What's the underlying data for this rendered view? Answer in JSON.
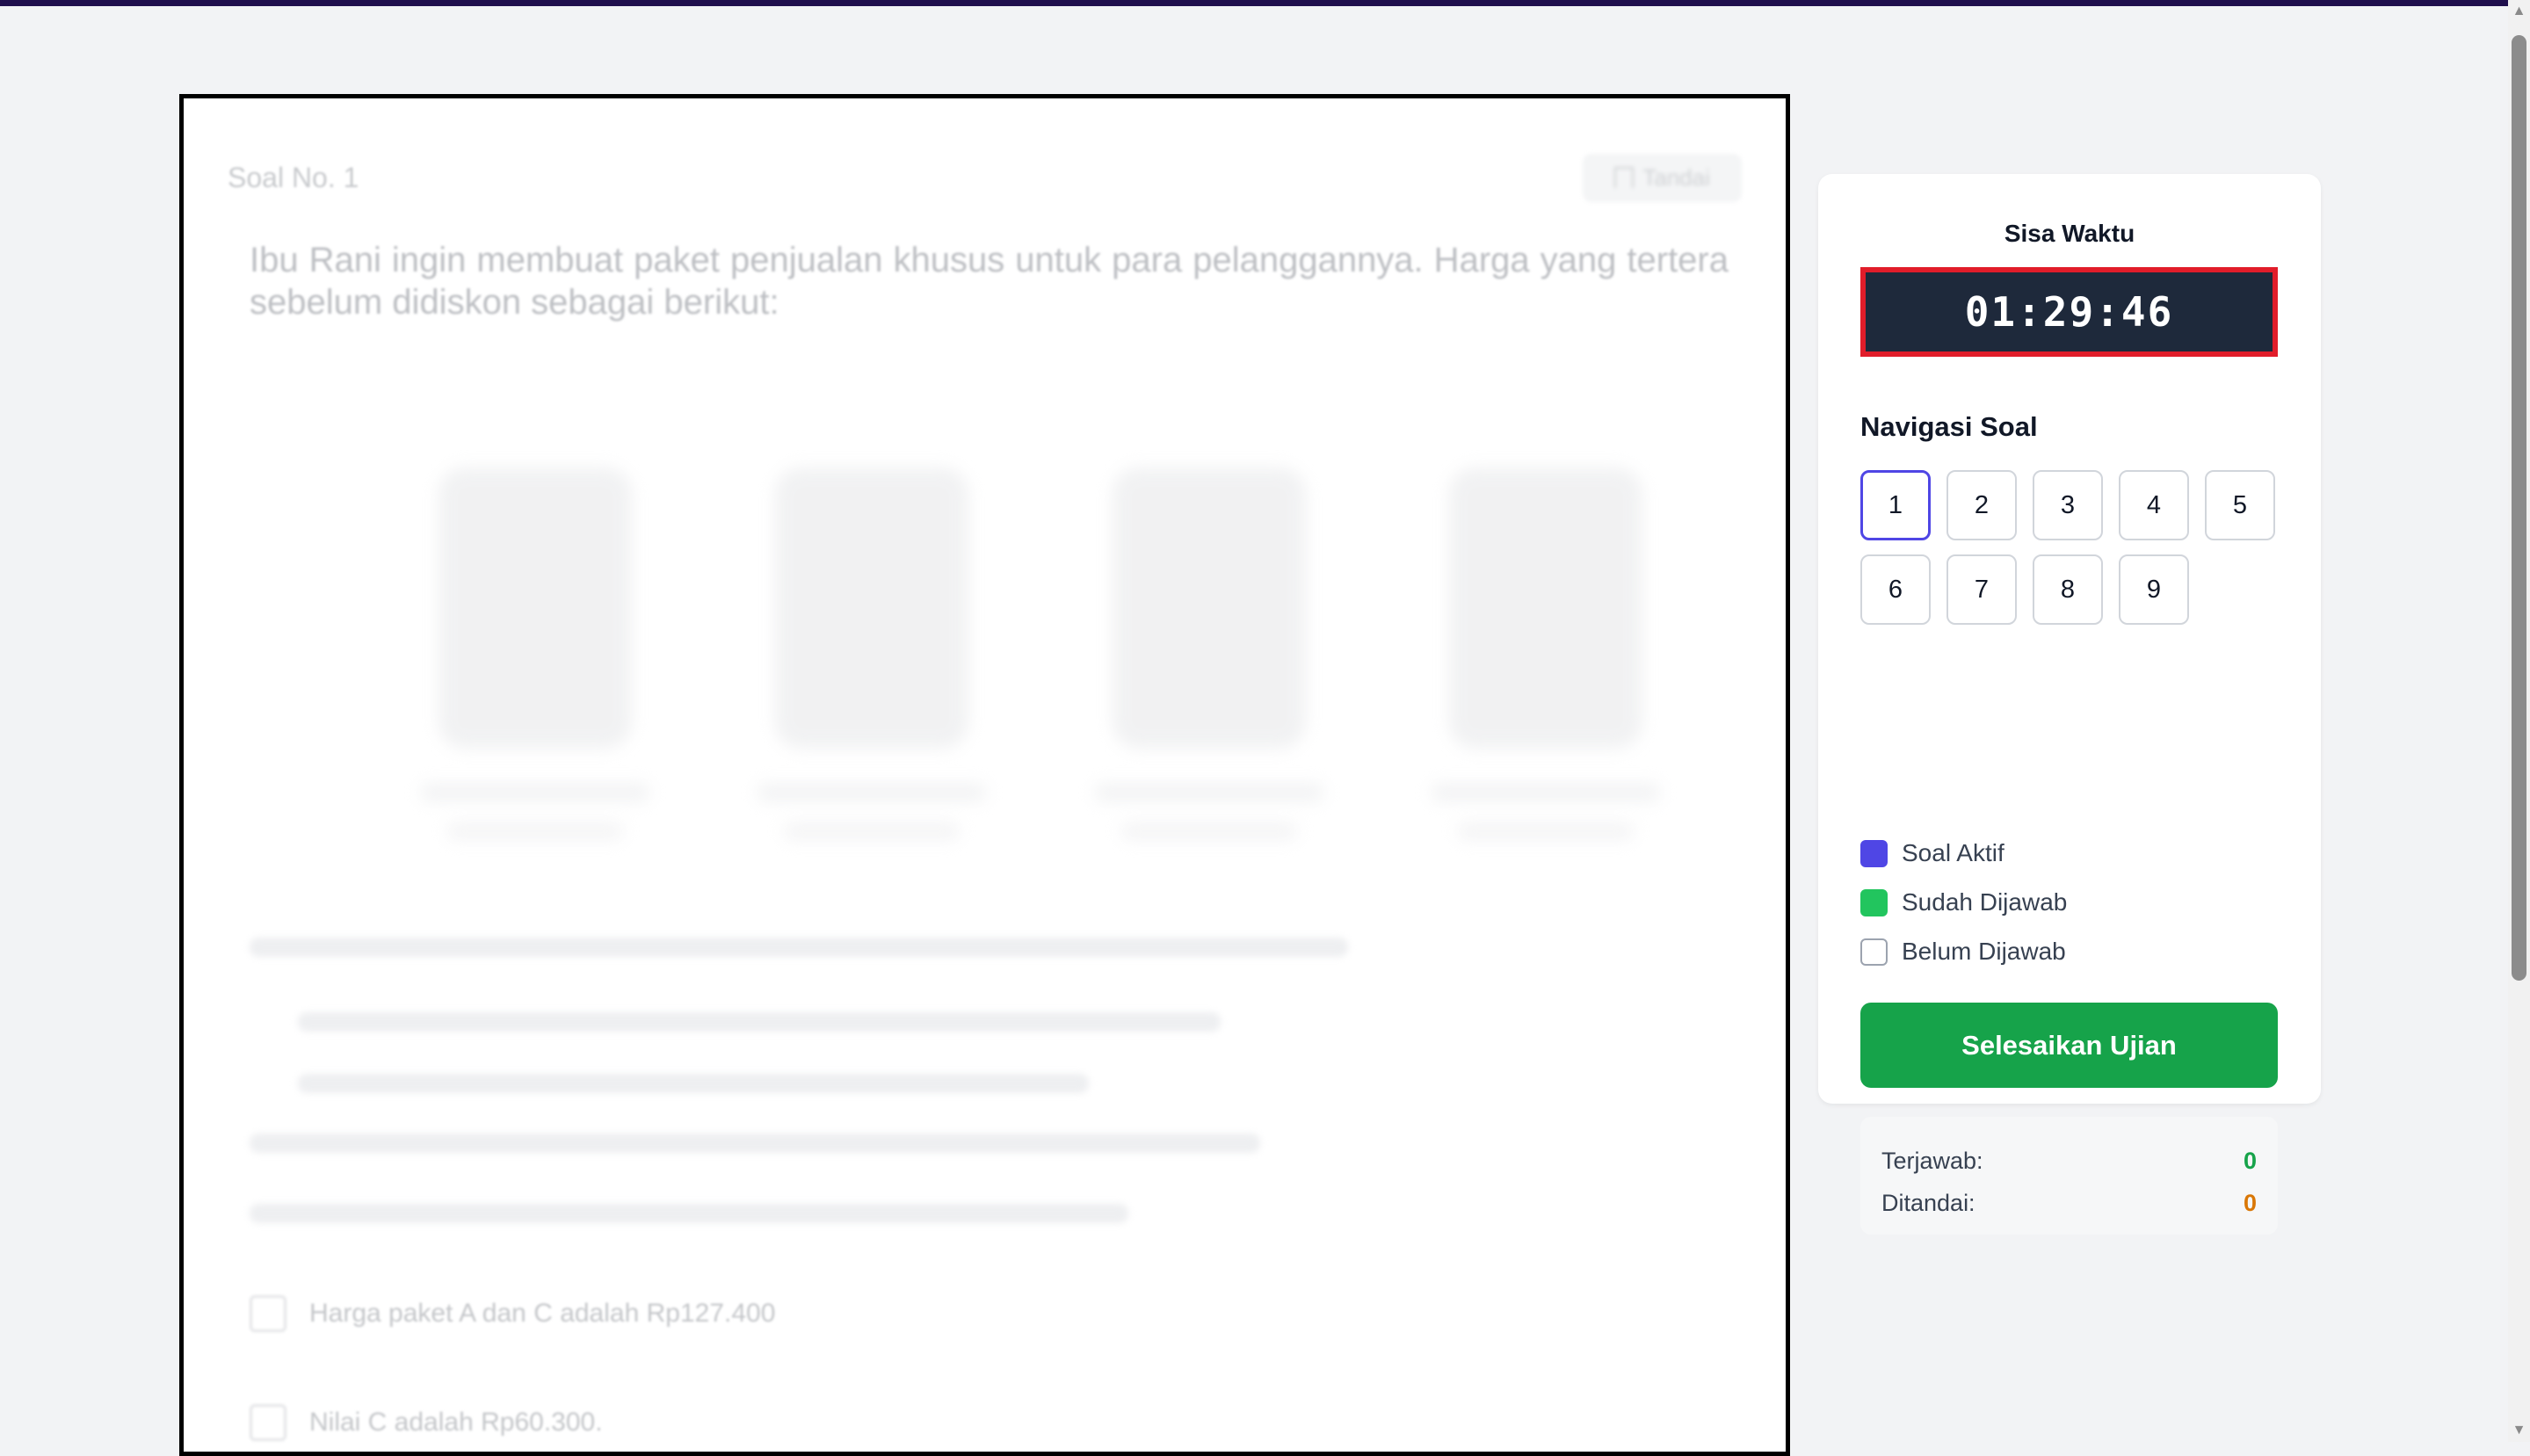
{
  "question": {
    "number_label": "Soal No. 1",
    "mark_label": "Tandai",
    "text": "Ibu Rani ingin membuat paket penjualan khusus untuk para pelanggannya. Harga yang tertera sebelum didiskon sebagai berikut:",
    "options": [
      {
        "text": "Harga paket A dan C adalah Rp127.400"
      },
      {
        "text": "Nilai C adalah Rp60.300."
      }
    ]
  },
  "sidebar": {
    "timer_label": "Sisa Waktu",
    "timer_value": "01:29:46",
    "nav_title": "Navigasi Soal",
    "nav_buttons": [
      "1",
      "2",
      "3",
      "4",
      "5",
      "6",
      "7",
      "8",
      "9"
    ],
    "active_question": "1",
    "legend": [
      {
        "label": "Soal Aktif",
        "color": "#4f46e5"
      },
      {
        "label": "Sudah Dijawab",
        "color": "#22c55e"
      },
      {
        "label": "Belum Dijawab",
        "color": "#ffffff"
      }
    ],
    "finish_label": "Selesaikan Ujian",
    "summary": {
      "answered_label": "Terjawab:",
      "answered_value": "0",
      "answered_color": "#16a34a",
      "marked_label": "Ditandai:",
      "marked_value": "0",
      "marked_color": "#d97706"
    }
  },
  "colors": {
    "timer_bg": "#1e293b",
    "timer_border": "#e11d2a",
    "finish_bg": "#16a34a",
    "active_border": "#4f46e5"
  }
}
